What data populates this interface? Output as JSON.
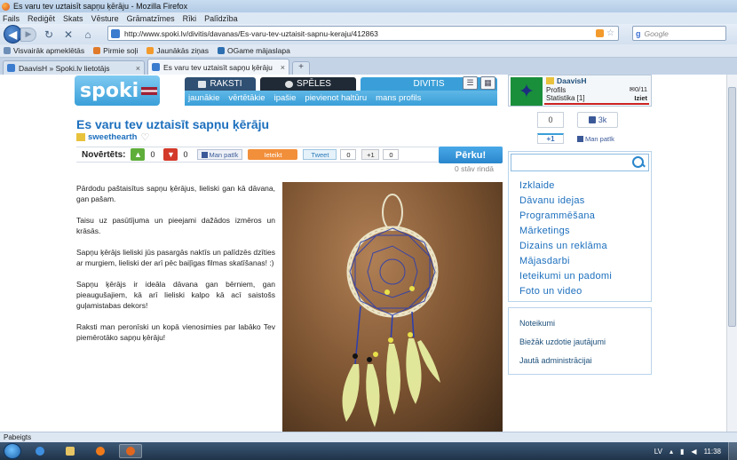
{
  "window": {
    "title": "Es varu tev uztaisīt sapņu ķērāju - Mozilla Firefox"
  },
  "menu": [
    "Fails",
    "Rediģēt",
    "Skats",
    "Vēsture",
    "Grāmatzīmes",
    "Rīki",
    "Palīdzība"
  ],
  "address": {
    "url": "http://www.spoki.lv/divitis/davanas/Es-varu-tev-uztaisit-sapnu-keraju/412863"
  },
  "search": {
    "placeholder": "Google"
  },
  "bookmarks": [
    "Visvairāk apmeklētās",
    "Pirmie soļi",
    "Jaunākās ziņas",
    "OGame mājaslapa"
  ],
  "tabs": [
    {
      "label": "DaavisH » Spoki.lv lietotājs",
      "active": false
    },
    {
      "label": "Es varu tev uztaisīt sapņu ķērāju",
      "active": true
    }
  ],
  "site": {
    "logo": "spoki",
    "nav_tabs": [
      "RAKSTI",
      "SPĒLES",
      "DIVITIS"
    ],
    "subnav": [
      "jaunākie",
      "vērtētākie",
      "ipašie",
      "pievienot haltūru",
      "mans profils"
    ]
  },
  "user": {
    "name": "DaavisH",
    "profile_label": "Profils",
    "stats_label": "Statistika [1]",
    "mail": "0/11",
    "logout": "Iziet"
  },
  "post": {
    "title": "Es varu tev uztaisīt sapņu ķērāju",
    "author": "sweethearth",
    "rated_label": "Novērtēts:",
    "up_count": "0",
    "down_count": "0",
    "fb_like": "Man patīk",
    "orange_btn": "Ieteikt",
    "tweet": "Tweet",
    "tweet_count": "0",
    "gplus": "+1",
    "gplus_count": "0",
    "buy_button": "Pērku!",
    "queue": "0 stāv rindā",
    "description": [
      "Pārdodu paštaisītus sapņu ķērājus, lieliski gan kā dāvana, gan pašam.",
      "Taisu uz pasūtījuma un pieejami dažādos izmēros un krāsās.",
      "Sapņu ķērājs lieliski jūs pasargās naktīs un palīdzēs dzīties ar murgiem, lieliski der arī pēc baiļīgas filmas skatīšanas! :)",
      "Sapņu ķērājs ir ideāla dāvana gan bērniem, gan pieaugušajiem, kā arī lieliski kalpo kā acī saistošs guļamistabas dekors!",
      "Raksti man peronīski un kopā vienosimies par labāko Tev piemērotāko sapņu ķērāju!"
    ]
  },
  "social": {
    "vote_count": "0",
    "plus1": "+1",
    "like_count": "3k",
    "man_patik": "Man patīk"
  },
  "sidebar": {
    "categories": [
      "Izklaide",
      "Dāvanu idejas",
      "Programmēšana",
      "Mārketings",
      "Dizains un reklāma",
      "Mājasdarbi",
      "Ieteikumi un padomi",
      "Foto un video"
    ],
    "links": [
      "Noteikumi",
      "Biežāk uzdotie jautājumi",
      "Jautā administrācijai"
    ]
  },
  "status": {
    "text": "Pabeigts"
  },
  "taskbar": {
    "lang": "LV",
    "clock": "11:38"
  },
  "colors": {
    "link": "#1c6fbd",
    "accent": "#3a9fd8",
    "buy": "#2a86cc"
  }
}
